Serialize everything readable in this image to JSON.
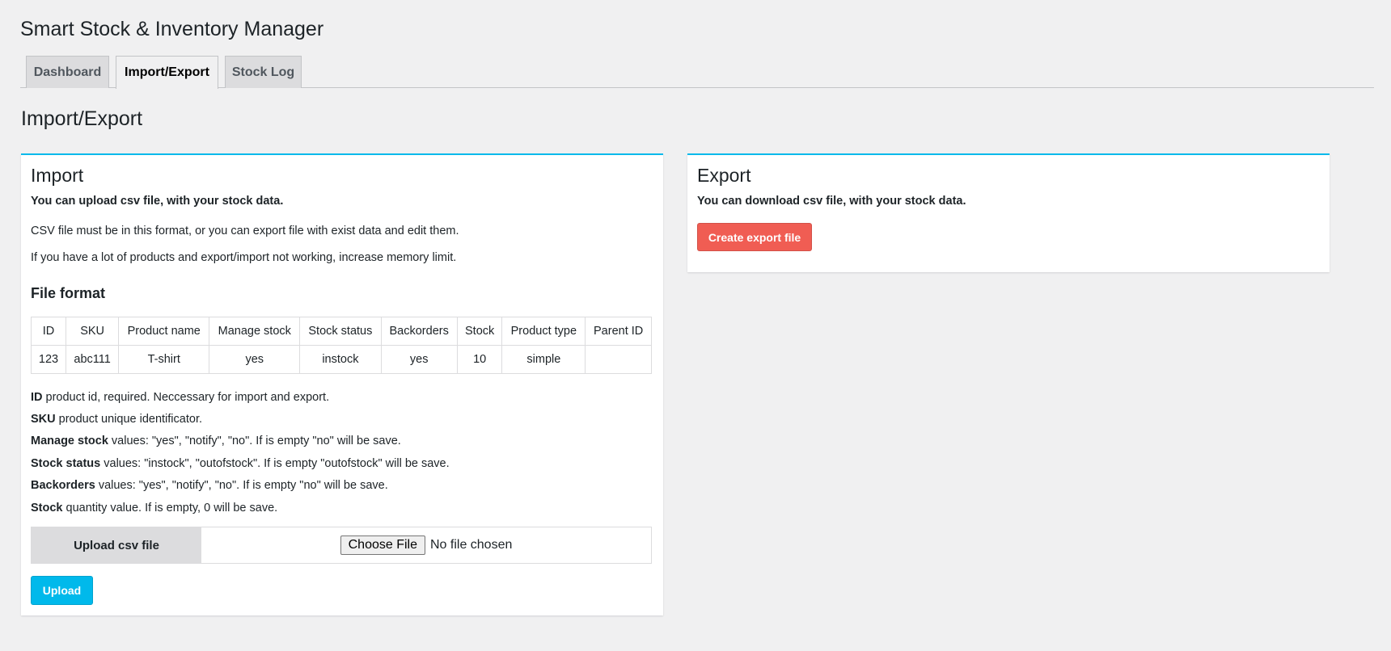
{
  "app": {
    "title": "Smart Stock & Inventory Manager"
  },
  "tabs": [
    {
      "label": "Dashboard",
      "active": false
    },
    {
      "label": "Import/Export",
      "active": true
    },
    {
      "label": "Stock Log",
      "active": false
    }
  ],
  "page": {
    "title": "Import/Export"
  },
  "import": {
    "title": "Import",
    "intro": "You can upload csv file, with your stock data.",
    "note1": "CSV file must be in this format, or you can export file with exist data and edit them.",
    "note2": "If you have a lot of products and export/import not working, increase memory limit.",
    "file_format_title": "File format",
    "table": {
      "headers": [
        "ID",
        "SKU",
        "Product name",
        "Manage stock",
        "Stock status",
        "Backorders",
        "Stock",
        "Product type",
        "Parent ID"
      ],
      "row": [
        "123",
        "abc111",
        "T-shirt",
        "yes",
        "instock",
        "yes",
        "10",
        "simple",
        ""
      ]
    },
    "descriptions": [
      {
        "term": "ID",
        "text": " product id, required. Neccessary for import and export."
      },
      {
        "term": "SKU",
        "text": " product unique identificator."
      },
      {
        "term": "Manage stock",
        "text": " values: \"yes\", \"notify\", \"no\". If is empty \"no\" will be save."
      },
      {
        "term": "Stock status",
        "text": " values: \"instock\", \"outofstock\". If is empty \"outofstock\" will be save."
      },
      {
        "term": "Backorders",
        "text": " values: \"yes\", \"notify\", \"no\". If is empty \"no\" will be save."
      },
      {
        "term": "Stock",
        "text": " quantity value. If is empty, 0 will be save."
      }
    ],
    "upload_label": "Upload csv file",
    "choose_file_label": "Choose File",
    "no_file_text": "No file chosen",
    "upload_button": "Upload"
  },
  "export": {
    "title": "Export",
    "intro": "You can download csv file, with your stock data.",
    "button": "Create export file"
  },
  "colors": {
    "accent_blue": "#00b9eb",
    "export_red": "#f05d53",
    "background": "#f0f0f1"
  }
}
